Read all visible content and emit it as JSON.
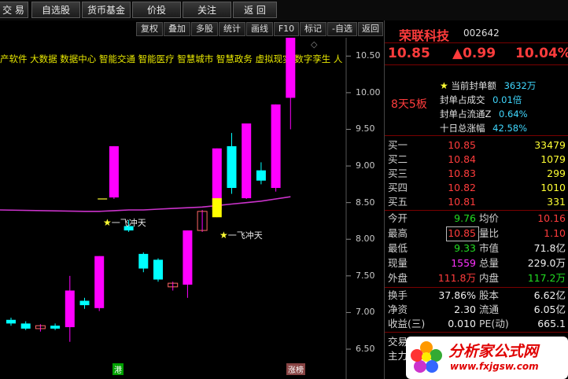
{
  "colors": {
    "up": "#ff00ff",
    "down": "#00ffff",
    "ma": "#cc33cc",
    "accent_red": "#ff3c3c"
  },
  "toolbar": [
    "交 易",
    "自选股",
    "货币基金",
    "价投",
    "关注",
    "返 回"
  ],
  "toolbar2": [
    "复权",
    "叠加",
    "多股",
    "统计",
    "画线",
    "F10",
    "标记",
    "-自选",
    "返回"
  ],
  "ticker": "产软件 大数据 数据中心 智能交通 智能医疗 智慧城市 智慧政务 虚拟现实 数字孪生 人",
  "y_axis_labels": [
    "10.50",
    "10.00",
    "9.50",
    "9.00",
    "8.50",
    "8.00",
    "7.50",
    "7.00",
    "6.50"
  ],
  "annotations": {
    "signal1": "一飞冲天",
    "signal2": "一飞冲天",
    "bottom_left": "港",
    "bottom_right": "涨榜"
  },
  "chart_data": {
    "type": "candlestick",
    "ylim": [
      6.35,
      10.75
    ],
    "candles": [
      {
        "o": 6.9,
        "c": 6.85,
        "h": 6.93,
        "l": 6.82
      },
      {
        "o": 6.85,
        "c": 6.78,
        "h": 6.88,
        "l": 6.76
      },
      {
        "o": 6.78,
        "c": 6.82,
        "h": 6.84,
        "l": 6.74
      },
      {
        "o": 6.82,
        "c": 6.78,
        "h": 6.85,
        "l": 6.76
      },
      {
        "o": 6.8,
        "c": 7.3,
        "h": 7.5,
        "l": 6.6
      },
      {
        "o": 7.16,
        "c": 7.1,
        "h": 7.2,
        "l": 7.05
      },
      {
        "o": 7.06,
        "c": 7.77,
        "h": 7.77,
        "l": 7.02
      },
      {
        "o": 8.57,
        "c": 9.27,
        "h": 9.27,
        "l": 8.55
      },
      {
        "o": 8.18,
        "c": 8.12,
        "h": 8.26,
        "l": 8.1
      },
      {
        "o": 7.8,
        "c": 7.6,
        "h": 7.82,
        "l": 7.55
      },
      {
        "o": 7.72,
        "c": 7.45,
        "h": 7.74,
        "l": 7.42
      },
      {
        "o": 7.35,
        "c": 7.4,
        "h": 7.42,
        "l": 7.3
      },
      {
        "o": 7.38,
        "c": 8.12,
        "h": 8.12,
        "l": 7.2
      },
      {
        "o": 8.12,
        "c": 8.38,
        "h": 8.4,
        "l": 8.1
      },
      {
        "o": 8.4,
        "c": 9.24,
        "h": 9.24,
        "l": 8.3
      },
      {
        "o": 9.27,
        "c": 8.7,
        "h": 9.45,
        "l": 8.62
      },
      {
        "o": 8.56,
        "c": 9.58,
        "h": 9.58,
        "l": 8.55
      },
      {
        "o": 8.94,
        "c": 8.8,
        "h": 9.05,
        "l": 8.75
      },
      {
        "o": 8.7,
        "c": 9.84,
        "h": 9.84,
        "l": 8.65
      },
      {
        "o": 9.93,
        "c": 10.85,
        "h": 10.85,
        "l": 9.5
      }
    ],
    "ma": [
      8.4,
      8.4,
      8.39,
      8.39,
      8.38,
      8.38,
      8.38,
      8.39,
      8.4,
      8.4,
      8.41,
      8.42,
      8.43,
      8.44,
      8.46,
      8.48,
      8.5,
      8.52,
      8.55,
      8.58
    ]
  },
  "stock": {
    "name": "荣联科技",
    "code": "002642",
    "price": "10.85",
    "change": "▲0.99",
    "pct": "10.04%"
  },
  "board": {
    "days": "8天5板",
    "items": [
      {
        "label": "当前封单额",
        "value": "3632万"
      },
      {
        "label": "封单占成交",
        "value": "0.01倍"
      },
      {
        "label": "封单占流通Z",
        "value": "0.64%"
      },
      {
        "label": "十日总涨幅",
        "value": "42.58%"
      }
    ]
  },
  "orderbook": [
    {
      "label": "买一",
      "price": "10.85",
      "vol": "33479"
    },
    {
      "label": "买二",
      "price": "10.84",
      "vol": "1079"
    },
    {
      "label": "买三",
      "price": "10.83",
      "vol": "299"
    },
    {
      "label": "买四",
      "price": "10.82",
      "vol": "1010"
    },
    {
      "label": "买五",
      "price": "10.81",
      "vol": "331"
    }
  ],
  "quote": [
    {
      "l1": "今开",
      "v1": "9.76",
      "c1": "grn",
      "l2": "均价",
      "v2": "10.16",
      "c2": "red"
    },
    {
      "l1": "最高",
      "v1": "10.85",
      "c1": "red",
      "l2": "量比",
      "v2": "1.10",
      "c2": "red"
    },
    {
      "l1": "最低",
      "v1": "9.33",
      "c1": "grn",
      "l2": "市值",
      "v2": "71.8亿",
      "c2": "wht"
    },
    {
      "l1": "现量",
      "v1": "1559",
      "c1": "mag",
      "l2": "总量",
      "v2": "229.0万",
      "c2": "wht"
    },
    {
      "l1": "外盘",
      "v1": "111.8万",
      "c1": "red",
      "l2": "内盘",
      "v2": "117.2万",
      "c2": "grn"
    }
  ],
  "fund": [
    {
      "l1": "换手",
      "v1": "37.86%",
      "l2": "股本",
      "v2": "6.62亿"
    },
    {
      "l1": "净资",
      "v1": "2.30",
      "l2": "流通",
      "v2": "6.05亿"
    },
    {
      "l1": "收益(三)",
      "v1": "0.010",
      "l2": "PE(动)",
      "v2": "665.1"
    }
  ],
  "tail": [
    "交易",
    "主力"
  ],
  "watermark": {
    "title": "分析家公式网",
    "url": "www.fxjgsw.com"
  }
}
